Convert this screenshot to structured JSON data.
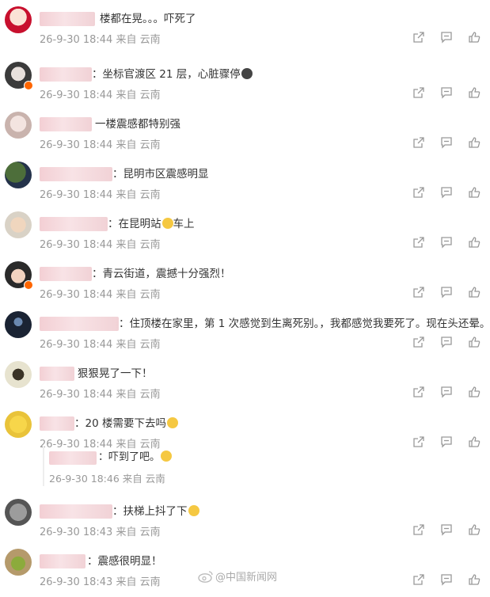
{
  "comments": [
    {
      "text": "楼都在晃。。。吓死了",
      "time": "26-9-30 18:44",
      "location": "来自 云南",
      "avatar": "red-cartoon-avatar",
      "emoji": ""
    },
    {
      "text": "：坐标官渡区 21 层，心脏骤停",
      "time": "26-9-30 18:44",
      "location": "来自 云南",
      "avatar": "person-avatar",
      "emoji": "eyes"
    },
    {
      "text": "一楼震感都特别强",
      "time": "26-9-30 18:44",
      "location": "来自 云南",
      "avatar": "girl-avatar",
      "emoji": ""
    },
    {
      "text": "：昆明市区震感明显",
      "time": "26-9-30 18:44",
      "location": "来自 云南",
      "avatar": "tree-avatar",
      "emoji": ""
    },
    {
      "text": "：在昆明站",
      "text2": "车上",
      "time": "26-9-30 18:44",
      "location": "来自 云南",
      "avatar": "child-avatar",
      "emoji": "cry-laugh"
    },
    {
      "text": "：青云街道，震撼十分强烈！",
      "time": "26-9-30 18:44",
      "location": "来自 云南",
      "avatar": "boy-avatar",
      "emoji": ""
    },
    {
      "text": "：住顶楼在家里，第 1 次感觉到生离死别。，我都感觉我要死了。现在头还晕。",
      "time": "26-9-30 18:44",
      "location": "来自 云南",
      "avatar": "dark-avatar",
      "emoji": ""
    },
    {
      "text": "狠狠晃了一下！",
      "time": "26-9-30 18:44",
      "location": "来自 云南",
      "avatar": "deer-avatar",
      "emoji": ""
    },
    {
      "text": "：20 楼需要下去吗",
      "time": "26-9-30 18:44",
      "location": "来自 云南",
      "avatar": "sponge-avatar",
      "emoji": "crying"
    },
    {
      "text": "：扶梯上抖了下",
      "time": "26-9-30 18:43",
      "location": "来自 云南",
      "avatar": "cat-avatar",
      "emoji": "cry-laugh"
    },
    {
      "text": "：震感很明显！",
      "time": "26-9-30 18:43",
      "location": "来自 云南",
      "avatar": "dog-avatar",
      "emoji": ""
    }
  ],
  "reply": {
    "text": "：吓到了吧。",
    "time": "26-9-30 18:46",
    "location": "来自 云南",
    "emoji": "cry-laugh"
  },
  "watermark": "@中国新闻网",
  "icons": {
    "share": "share-icon",
    "comment": "comment-icon",
    "like": "like-icon"
  }
}
